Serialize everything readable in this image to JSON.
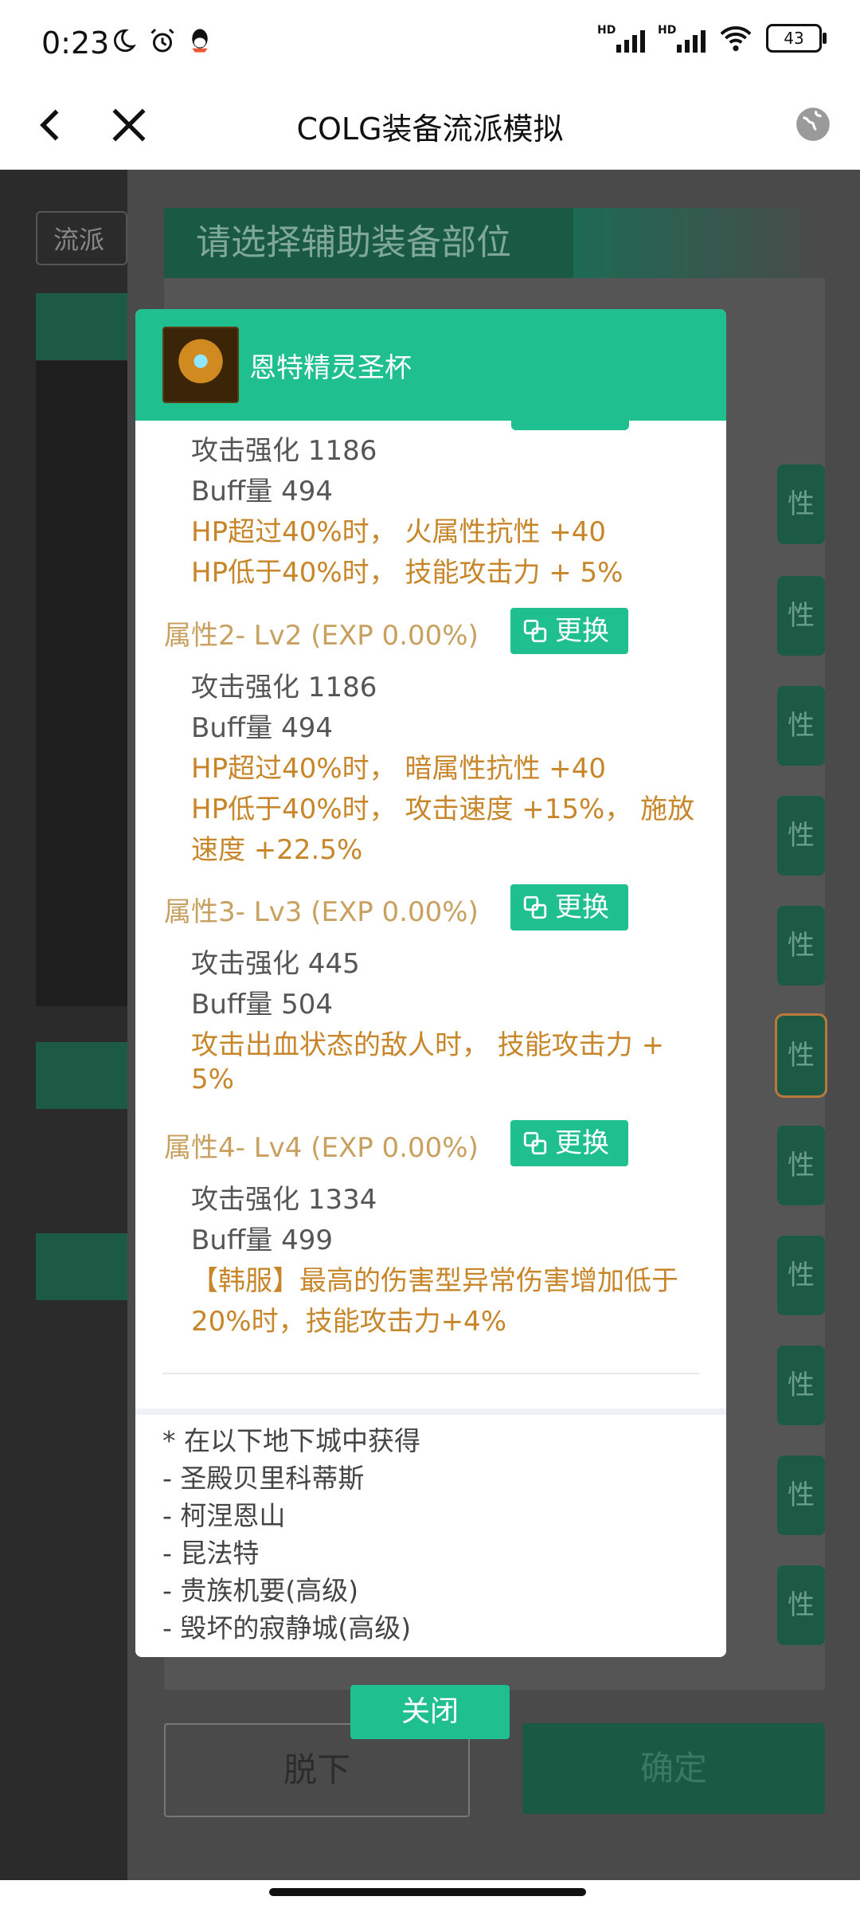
{
  "status_bar": {
    "time": "0:23",
    "signal1_label": "HD",
    "signal2_label": "HD",
    "battery": "43"
  },
  "titlebar": {
    "title": "COLG装备流派模拟"
  },
  "background": {
    "left_box": "流派"
  },
  "panel": {
    "banner": "请选择辅助装备部位",
    "slot_label": "性",
    "unequip": "脱下",
    "confirm": "确定"
  },
  "modal": {
    "item_name": "恩特精灵圣杯",
    "attributes": [
      {
        "stats": [
          "攻击强化 1186",
          "Buff量 494"
        ],
        "effects": [
          "HP超过40%时， 火属性抗性 +40",
          "HP低于40%时， 技能攻击力 + 5%"
        ]
      },
      {
        "header": "属性2- Lv2 (EXP 0.00%)",
        "change": "更换",
        "stats": [
          "攻击强化 1186",
          "Buff量 494"
        ],
        "effects": [
          "HP超过40%时， 暗属性抗性 +40",
          "HP低于40%时， 攻击速度 +15%， 施放",
          "速度 +22.5%"
        ]
      },
      {
        "header": "属性3- Lv3 (EXP 0.00%)",
        "change": "更换",
        "stats": [
          "攻击强化 445",
          "Buff量 504"
        ],
        "effects": [
          "攻击出血状态的敌人时， 技能攻击力 +",
          "5%"
        ]
      },
      {
        "header": "属性4- Lv4 (EXP 0.00%)",
        "change": "更换",
        "stats": [
          "攻击强化 1334",
          "Buff量 499"
        ],
        "effects": [
          "【韩服】最高的伤害型异常伤害增加低于",
          "20%时，技能攻击力+4%"
        ]
      }
    ],
    "obtain": [
      "* 在以下地下城中获得",
      "- 圣殿贝里科蒂斯",
      "- 柯涅恩山",
      "- 昆法特",
      "- 贵族机要(高级)",
      "- 毁坏的寂静城(高级)"
    ],
    "close": "关闭"
  },
  "colors": {
    "accent": "#1fbf8f",
    "attr_header": "#c8a060",
    "effect_text": "#c8862a"
  }
}
